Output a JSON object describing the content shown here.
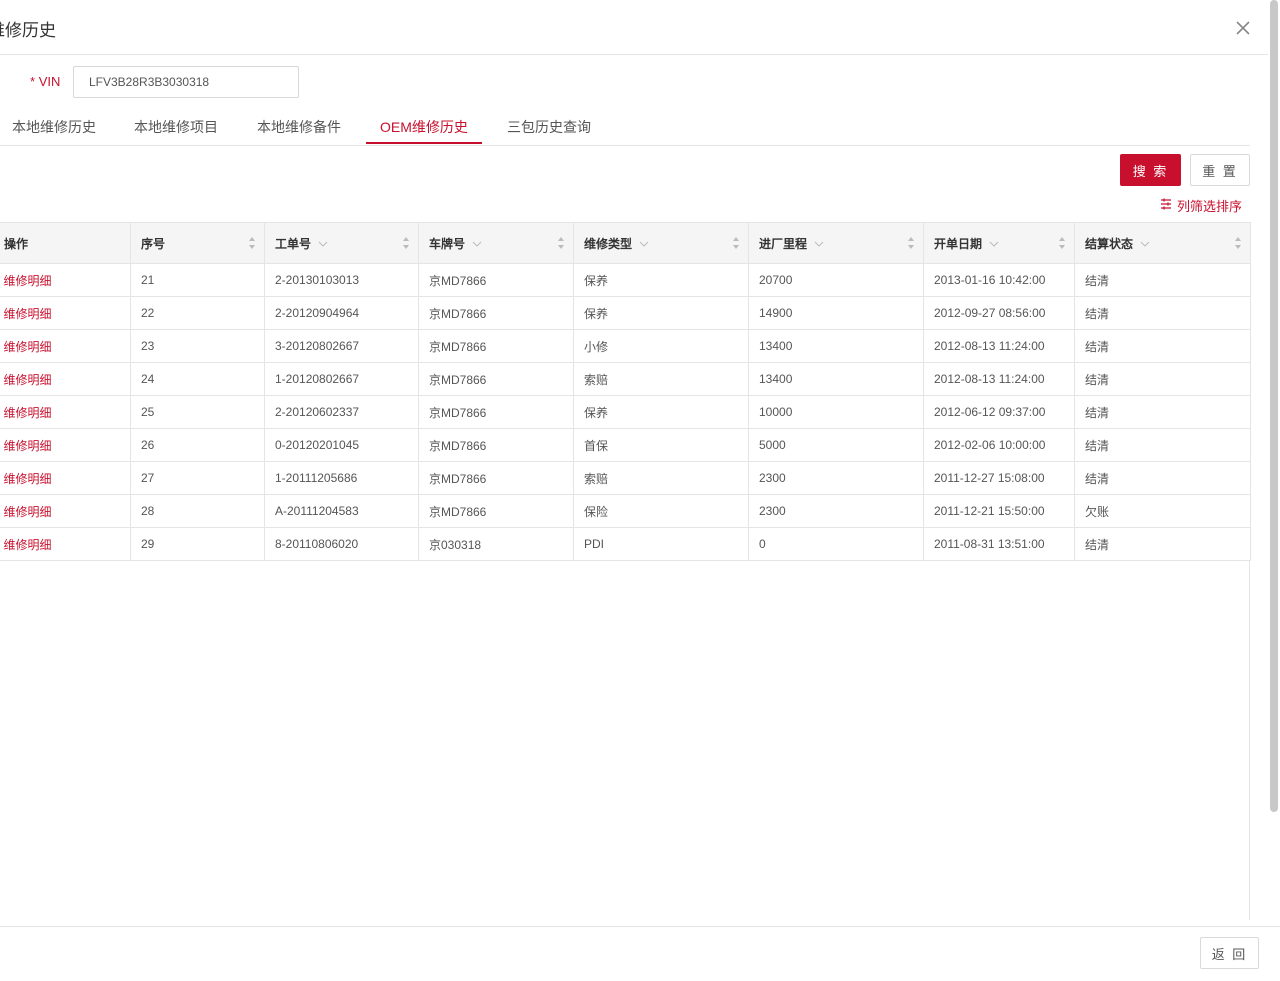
{
  "dialog": {
    "title": "维修历史"
  },
  "form": {
    "vin_required_mark": "*",
    "vin_label": "VIN",
    "vin_value": "LFV3B28R3B3030318"
  },
  "tabs": [
    {
      "label": "本地维修历史",
      "active": false
    },
    {
      "label": "本地维修项目",
      "active": false
    },
    {
      "label": "本地维修备件",
      "active": false
    },
    {
      "label": "OEM维修历史",
      "active": true
    },
    {
      "label": "三包历史查询",
      "active": false
    }
  ],
  "buttons": {
    "search": "搜 索",
    "reset": "重 置",
    "back": "返 回"
  },
  "column_filter_label": "列筛选排序",
  "table": {
    "headers": [
      "操作",
      "序号",
      "工单号",
      "车牌号",
      "维修类型",
      "进厂里程",
      "开单日期",
      "结算状态"
    ],
    "rows": [
      [
        "维修明细",
        "21",
        "2-20130103013",
        "京MD7866",
        "保养",
        "20700",
        "2013-01-16 10:42:00",
        "结清"
      ],
      [
        "维修明细",
        "22",
        "2-20120904964",
        "京MD7866",
        "保养",
        "14900",
        "2012-09-27 08:56:00",
        "结清"
      ],
      [
        "维修明细",
        "23",
        "3-20120802667",
        "京MD7866",
        "小修",
        "13400",
        "2012-08-13 11:24:00",
        "结清"
      ],
      [
        "维修明细",
        "24",
        "1-20120802667",
        "京MD7866",
        "索赔",
        "13400",
        "2012-08-13 11:24:00",
        "结清"
      ],
      [
        "维修明细",
        "25",
        "2-20120602337",
        "京MD7866",
        "保养",
        "10000",
        "2012-06-12 09:37:00",
        "结清"
      ],
      [
        "维修明细",
        "26",
        "0-20120201045",
        "京MD7866",
        "首保",
        "5000",
        "2012-02-06 10:00:00",
        "结清"
      ],
      [
        "维修明细",
        "27",
        "1-20111205686",
        "京MD7866",
        "索赔",
        "2300",
        "2011-12-27 15:08:00",
        "结清"
      ],
      [
        "维修明细",
        "28",
        "A-20111204583",
        "京MD7866",
        "保险",
        "2300",
        "2011-12-21 15:50:00",
        "欠账"
      ],
      [
        "维修明细",
        "29",
        "8-20110806020",
        "京030318",
        "PDI",
        "0",
        "2011-08-31 13:51:00",
        "结清"
      ]
    ]
  },
  "colors": {
    "accent": "#c8102e",
    "header_bg": "#f5f5f5",
    "border": "#e5e5e5"
  },
  "icons": {
    "close": "close-icon",
    "filter": "filter-icon",
    "sort": "sort-icon",
    "chevron": "chevron-down-icon"
  }
}
